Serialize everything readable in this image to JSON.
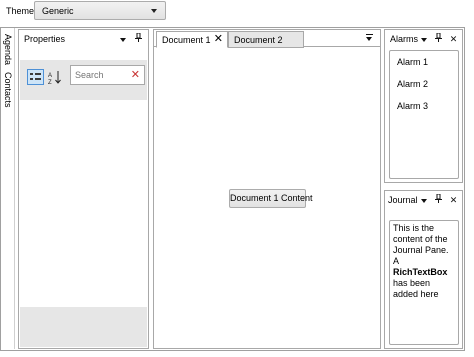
{
  "theme": {
    "label": "Theme:",
    "selected": "Generic"
  },
  "autohide_tabs": [
    "Agenda",
    "Contacts"
  ],
  "properties_pane": {
    "title": "Properties",
    "search_placeholder": "Search"
  },
  "documents": {
    "tabs": [
      {
        "label": "Document 1",
        "active": true
      },
      {
        "label": "Document 2",
        "active": false
      }
    ],
    "content_button": "Document 1 Content"
  },
  "alarms_pane": {
    "title": "Alarms",
    "items": [
      "Alarm 1",
      "Alarm 2",
      "Alarm 3"
    ]
  },
  "journal_pane": {
    "title": "Journal",
    "content": {
      "before": "This is the content of the Journal Pane. A ",
      "bold": "RichTextBox",
      "after": " has been added here"
    }
  },
  "colors": {
    "border": "#a8a8a8",
    "toolbar_bg": "#e6e6e6",
    "selected_button_bg": "#cde4f7",
    "selected_button_border": "#4d90d6",
    "clear_icon": "#c83232"
  },
  "icons": {
    "dropdown": "chevron-down-icon",
    "pin": "pin-icon",
    "close": "close-icon",
    "categorize": "categorize-icon",
    "sort": "sort-alpha-icon",
    "clear": "clear-search-icon",
    "document_menu": "document-list-icon"
  }
}
